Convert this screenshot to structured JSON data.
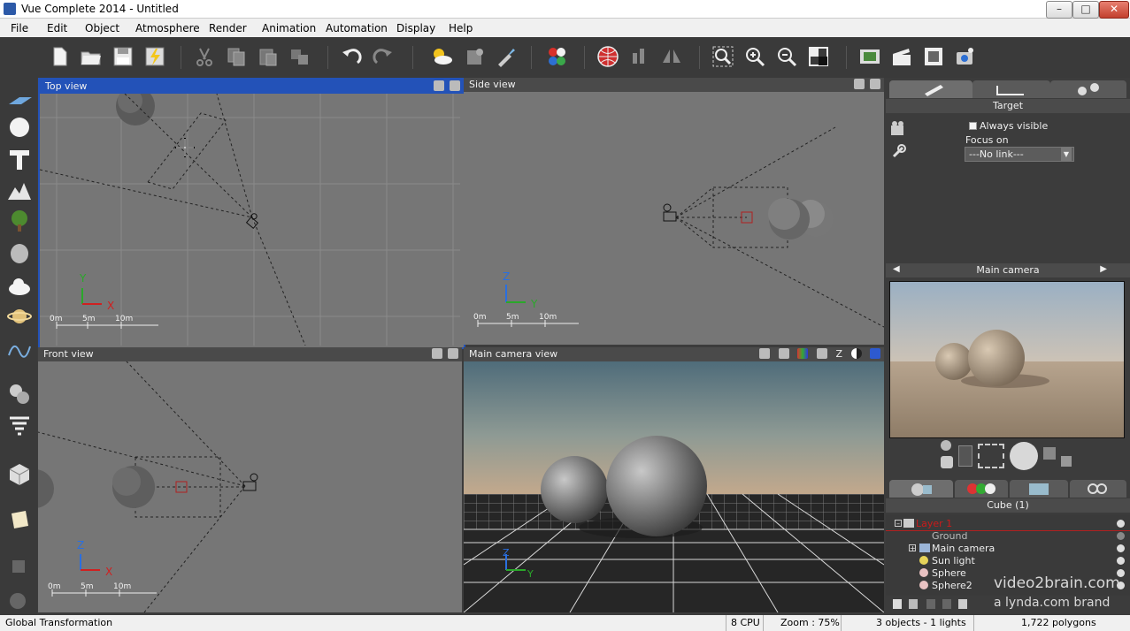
{
  "window": {
    "title": "Vue Complete 2014 - Untitled",
    "buttons": [
      "minimize",
      "maximize",
      "close"
    ]
  },
  "menu": [
    "File",
    "Edit",
    "Object",
    "Atmosphere",
    "Render",
    "Animation",
    "Automation",
    "Display",
    "Help"
  ],
  "toolbar": {
    "icons": [
      "new-file-icon",
      "open-folder-icon",
      "save-icon",
      "lightning-save-icon",
      "cut-icon",
      "copy-icon",
      "paste-icon",
      "duplicate-icon",
      "undo-icon",
      "redo-icon",
      "atmosphere-icon",
      "material-icon",
      "brush-icon",
      "color-balls-icon",
      "render-globe-icon",
      "bars-icon",
      "mirror-icon",
      "zoom-frame-icon",
      "zoom-in-icon",
      "zoom-out-icon",
      "fit-icon",
      "film-strip-icon",
      "clapper-icon",
      "frame-icon",
      "render-camera-icon"
    ]
  },
  "left_tools": [
    "plane-icon",
    "sphere-icon",
    "text-icon",
    "terrain-icon",
    "tree-icon",
    "rock-icon",
    "cloud-icon",
    "planet-icon",
    "curve-icon",
    "metablob-icon",
    "tornado-icon",
    "cube-icon",
    "note-icon",
    "stack-icon",
    "group-icon"
  ],
  "viewports": {
    "top": {
      "title": "Top view"
    },
    "side": {
      "title": "Side view"
    },
    "front": {
      "title": "Front view"
    },
    "camera": {
      "title": "Main camera view"
    }
  },
  "scale": {
    "m0": "0m",
    "m5": "5m",
    "m10": "10m"
  },
  "axes": {
    "x": "X",
    "y": "Y",
    "z": "Z"
  },
  "camera_header_z": "Z",
  "right_panel": {
    "target_header": "Target",
    "always_visible_label": "Always visible",
    "always_visible_checked": false,
    "focus_on_label": "Focus on",
    "focus_on_value": "---No link---",
    "preview_header": "Main camera",
    "world_header": "Cube (1)",
    "tree": [
      {
        "label": "Layer 1",
        "color": "#cc1a1a"
      },
      {
        "label": "Ground",
        "color": "#bbbbbb"
      },
      {
        "label": "Main camera",
        "color": "#eeeeee"
      },
      {
        "label": "Sun light",
        "color": "#eeeeee"
      },
      {
        "label": "Sphere",
        "color": "#eeeeee"
      },
      {
        "label": "Sphere2",
        "color": "#eeeeee"
      }
    ]
  },
  "watermark": {
    "line1": "video2brain.com",
    "line2": "a lynda.com brand"
  },
  "status": {
    "left": "Global Transformation",
    "cpu": "8 CPU",
    "zoom": "Zoom : 75%",
    "objects": "3 objects - 1 lights",
    "polygons": "1,722 polygons"
  }
}
